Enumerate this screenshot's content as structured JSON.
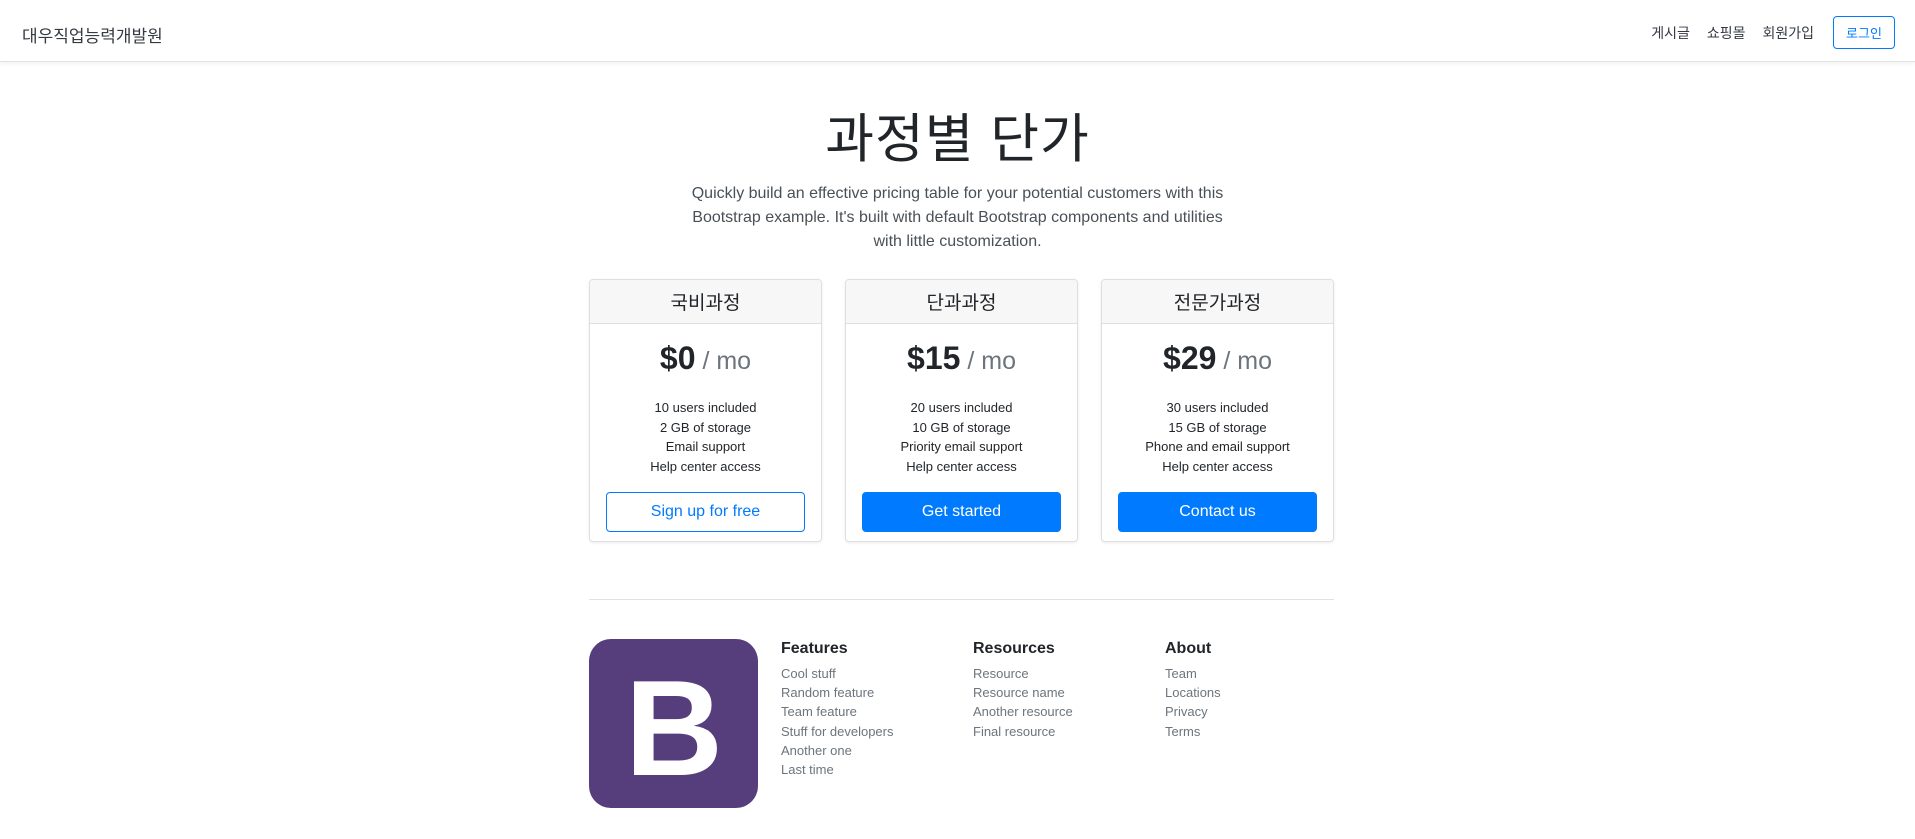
{
  "header": {
    "brand": "대우직업능력개발원",
    "nav": [
      "게시글",
      "쇼핑몰",
      "회원가입"
    ],
    "login": "로그인"
  },
  "hero": {
    "title": "과정별 단가",
    "lead": "Quickly build an effective pricing table for your potential customers with this Bootstrap example. It's built with default Bootstrap components and utilities with little customization."
  },
  "plans": [
    {
      "name": "국비과정",
      "price": "$0",
      "period": " / mo",
      "features": [
        "10 users included",
        "2 GB of storage",
        "Email support",
        "Help center access"
      ],
      "button": "Sign up for free"
    },
    {
      "name": "단과과정",
      "price": "$15",
      "period": " / mo",
      "features": [
        "20 users included",
        "10 GB of storage",
        "Priority email support",
        "Help center access"
      ],
      "button": "Get started"
    },
    {
      "name": "전문가과정",
      "price": "$29",
      "period": " / mo",
      "features": [
        "30 users included",
        "15 GB of storage",
        "Phone and email support",
        "Help center access"
      ],
      "button": "Contact us"
    }
  ],
  "footer": {
    "logo_icon": "bootstrap-logo-icon",
    "logo_letter": "B",
    "columns": [
      {
        "title": "Features",
        "links": [
          "Cool stuff",
          "Random feature",
          "Team feature",
          "Stuff for developers",
          "Another one",
          "Last time"
        ]
      },
      {
        "title": "Resources",
        "links": [
          "Resource",
          "Resource name",
          "Another resource",
          "Final resource"
        ]
      },
      {
        "title": "About",
        "links": [
          "Team",
          "Locations",
          "Privacy",
          "Terms"
        ]
      }
    ]
  },
  "colors": {
    "primary": "#007bff",
    "logo_bg": "#563d7c"
  }
}
